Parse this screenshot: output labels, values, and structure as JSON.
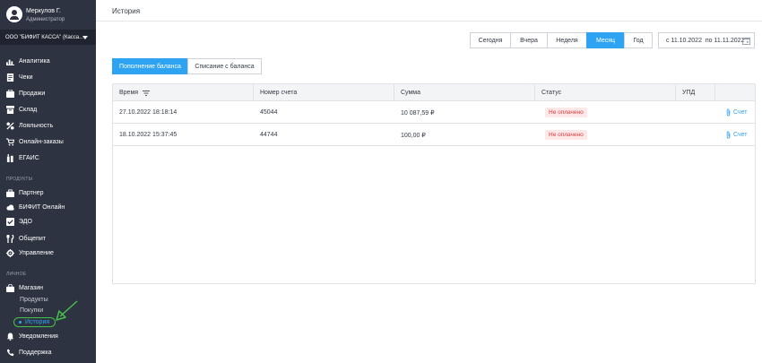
{
  "profile": {
    "name": "Меркулов Г.",
    "role": "Администратор"
  },
  "org": {
    "name": "ООО \"БИФИТ КАССА\" (Касса..."
  },
  "nav_main": [
    {
      "label": "Аналитика",
      "icon": "analytics-icon"
    },
    {
      "label": "Чеки",
      "icon": "receipt-icon"
    },
    {
      "label": "Продажи",
      "icon": "sales-icon"
    },
    {
      "label": "Склад",
      "icon": "warehouse-icon"
    },
    {
      "label": "Лояльность",
      "icon": "percent-icon"
    },
    {
      "label": "Онлайн-заказы",
      "icon": "cart-icon"
    },
    {
      "label": "ЕГАИС",
      "icon": "bottle-icon"
    }
  ],
  "section_products": "ПРОДУКТЫ",
  "nav_products": [
    {
      "label": "Партнер",
      "icon": "briefcase-icon"
    },
    {
      "label": "БИФИТ Онлайн",
      "icon": "cloud-icon"
    },
    {
      "label": "ЭДО",
      "icon": "edo-icon"
    },
    {
      "label": "Общепит",
      "icon": "cutlery-icon"
    },
    {
      "label": "Управление",
      "icon": "gear-icon"
    }
  ],
  "section_personal": "ЛИЧНОЕ",
  "nav_personal": {
    "shop": {
      "label": "Магазин",
      "icon": "shop-icon"
    },
    "sub_items": [
      "Продукты",
      "Покупки"
    ],
    "active_sub": "История",
    "notifications": {
      "label": "Уведомления",
      "icon": "bell-icon"
    },
    "support": {
      "label": "Поддержка",
      "icon": "phone-icon"
    }
  },
  "header": {
    "title": "История"
  },
  "periods": [
    "Сегодня",
    "Вчера",
    "Неделя",
    "Месяц",
    "Год"
  ],
  "active_period": "Месяц",
  "date_range": "с 11.10.2022  по 11.11.2022",
  "tabs": {
    "topup": "Пополнение баланса",
    "writeoff": "Списание с баланса"
  },
  "table": {
    "columns": [
      "Время",
      "Номер счета",
      "Сумма",
      "Статус",
      "УПД",
      ""
    ],
    "rows": [
      {
        "time": "27.10.2022 18:18:14",
        "number": "45044",
        "amount": "10 087,59 ₽",
        "status": "Не оплачено",
        "upd": "",
        "link": "Счет"
      },
      {
        "time": "18.10.2022 15:37:45",
        "number": "44744",
        "amount": "100,00 ₽",
        "status": "Не оплачено",
        "upd": "",
        "link": "Счет"
      }
    ]
  },
  "colors": {
    "accent": "#2ea3f2",
    "sidebar": "#2d3340",
    "status_bg": "#fde7e7",
    "status_text": "#e0393e",
    "annotation": "#46c04b"
  }
}
